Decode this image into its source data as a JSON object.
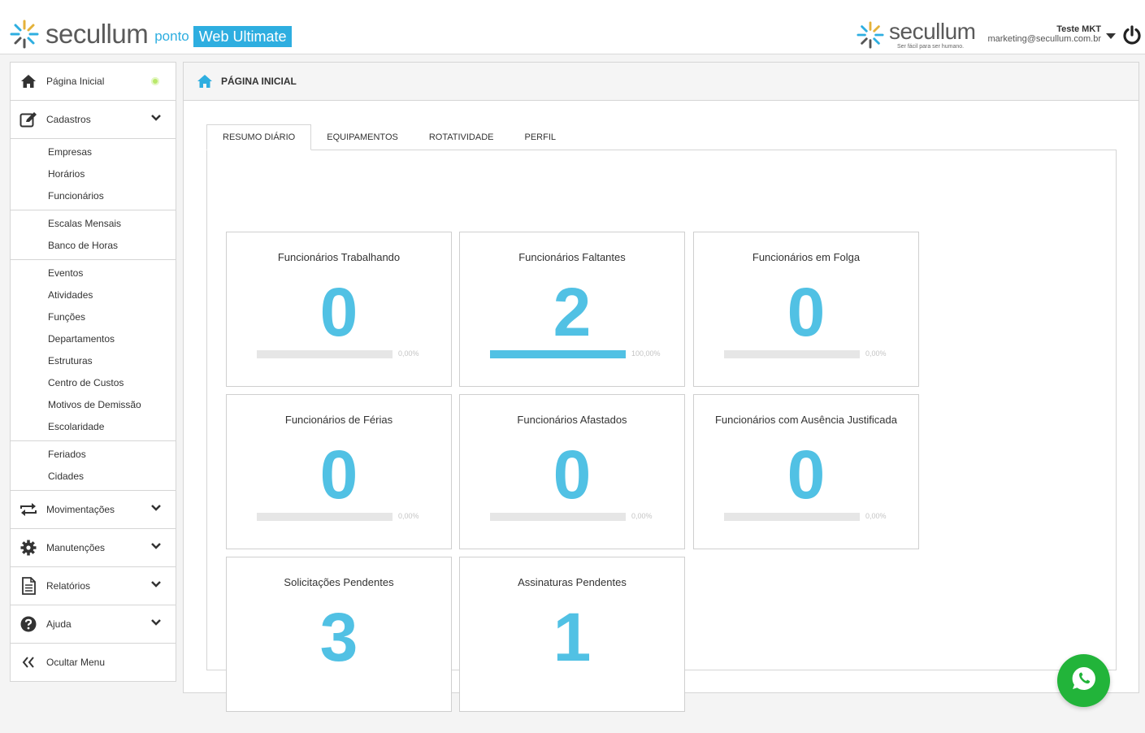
{
  "header": {
    "brand_word": "secullum",
    "brand_product": "ponto",
    "brand_badge": "Web Ultimate",
    "partner_word": "secullum",
    "partner_tagline": "Ser fácil para ser humano.",
    "user_name": "Teste MKT",
    "user_email": "marketing@secullum.com.br"
  },
  "sidebar": {
    "home_label": "Página Inicial",
    "cadastros_label": "Cadastros",
    "cadastros_groups": [
      [
        "Empresas",
        "Horários",
        "Funcionários"
      ],
      [
        "Escalas Mensais",
        "Banco de Horas"
      ],
      [
        "Eventos",
        "Atividades",
        "Funções",
        "Departamentos",
        "Estruturas",
        "Centro de Custos",
        "Motivos de Demissão",
        "Escolaridade"
      ],
      [
        "Feriados",
        "Cidades"
      ]
    ],
    "movimentacoes_label": "Movimentações",
    "manutencoes_label": "Manutenções",
    "relatorios_label": "Relatórios",
    "ajuda_label": "Ajuda",
    "hide_label": "Ocultar Menu"
  },
  "main": {
    "title": "PÁGINA INICIAL",
    "tabs": [
      "RESUMO DIÁRIO",
      "EQUIPAMENTOS",
      "ROTATIVIDADE",
      "PERFIL"
    ],
    "active_tab": 0,
    "cards": [
      {
        "title": "Funcionários Trabalhando",
        "value": "0",
        "percent_label": "0,00%",
        "fraction": 0.0
      },
      {
        "title": "Funcionários Faltantes",
        "value": "2",
        "percent_label": "100,00%",
        "fraction": 1.0
      },
      {
        "title": "Funcionários em Folga",
        "value": "0",
        "percent_label": "0,00%",
        "fraction": 0.0
      },
      {
        "title": "Funcionários de Férias",
        "value": "0",
        "percent_label": "0,00%",
        "fraction": 0.0
      },
      {
        "title": "Funcionários Afastados",
        "value": "0",
        "percent_label": "0,00%",
        "fraction": 0.0
      },
      {
        "title": "Funcionários com Ausência Justificada",
        "value": "0",
        "percent_label": "0,00%",
        "fraction": 0.0
      },
      {
        "title": "Solicitações Pendentes",
        "value": "3"
      },
      {
        "title": "Assinaturas Pendentes",
        "value": "1"
      }
    ]
  },
  "colors": {
    "accent": "#2eaee0",
    "value": "#51c1e4",
    "whatsapp": "#22b43a"
  }
}
